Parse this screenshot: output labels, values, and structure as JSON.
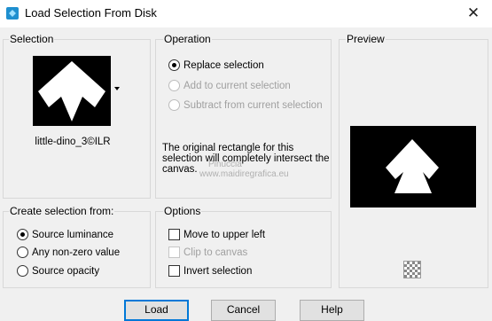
{
  "window": {
    "title": "Load Selection From Disk",
    "close_glyph": "✕",
    "icon": "app-icon"
  },
  "selection": {
    "label": "Selection",
    "thumbnail_name": "little-dino_3©ILR"
  },
  "operation": {
    "label": "Operation",
    "options": [
      {
        "label": "Replace selection",
        "checked": true,
        "enabled": true
      },
      {
        "label": "Add to current selection",
        "checked": false,
        "enabled": false
      },
      {
        "label": "Subtract from current selection",
        "checked": false,
        "enabled": false
      }
    ],
    "description": "The original rectangle for this selection will completely intersect the canvas."
  },
  "preview": {
    "label": "Preview",
    "checker_icon": "transparency-checker-icon"
  },
  "create_from": {
    "label": "Create selection from:",
    "options": [
      {
        "label": "Source luminance",
        "checked": true
      },
      {
        "label": "Any non-zero value",
        "checked": false
      },
      {
        "label": "Source opacity",
        "checked": false
      }
    ]
  },
  "options": {
    "label": "Options",
    "items": [
      {
        "label": "Move to upper left",
        "checked": false,
        "enabled": true
      },
      {
        "label": "Clip to canvas",
        "checked": false,
        "enabled": false
      },
      {
        "label": "Invert selection",
        "checked": false,
        "enabled": true
      }
    ]
  },
  "watermark": {
    "line1": "Pinuccia",
    "line2": "www.maidiregrafica.eu"
  },
  "buttons": {
    "load": "Load",
    "cancel": "Cancel",
    "help": "Help"
  }
}
